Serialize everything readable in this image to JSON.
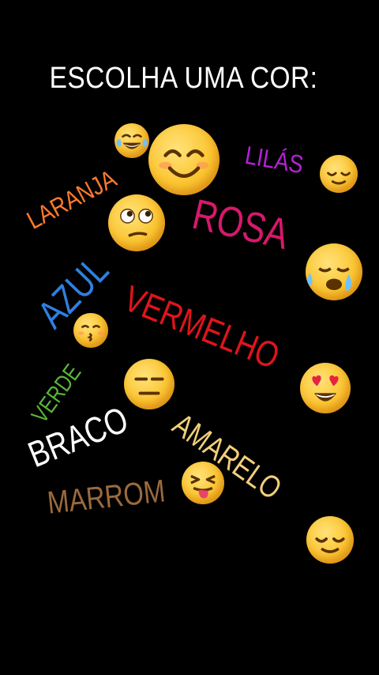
{
  "title": "ESCOLHA UMA COR:",
  "colors": {
    "laranja": {
      "label": "LARANJA",
      "color": "#ff7a2e"
    },
    "lilas": {
      "label": "LILÁS",
      "color": "#b620d6"
    },
    "rosa": {
      "label": "ROSA",
      "color": "#d7186b"
    },
    "azul": {
      "label": "AZUL",
      "color": "#2f7fe0"
    },
    "vermelho": {
      "label": "VERMELHO",
      "color": "#e0141b"
    },
    "verde": {
      "label": "VERDE",
      "color": "#59b53a"
    },
    "braco": {
      "label": "BRACO",
      "color": "#ffffff"
    },
    "amarelo": {
      "label": "AMARELO",
      "color": "#f1cf7a"
    },
    "marrom": {
      "label": "MARROM",
      "color": "#9a6a3d"
    }
  },
  "emojis": [
    "tears-of-joy-emoji",
    "smiling-emoji",
    "relieved-emoji",
    "dizzy-eyes-emoji",
    "crying-emoji",
    "kissing-emoji",
    "expressionless-emoji",
    "heart-eyes-emoji",
    "tongue-out-emoji",
    "relieved-emoji"
  ]
}
